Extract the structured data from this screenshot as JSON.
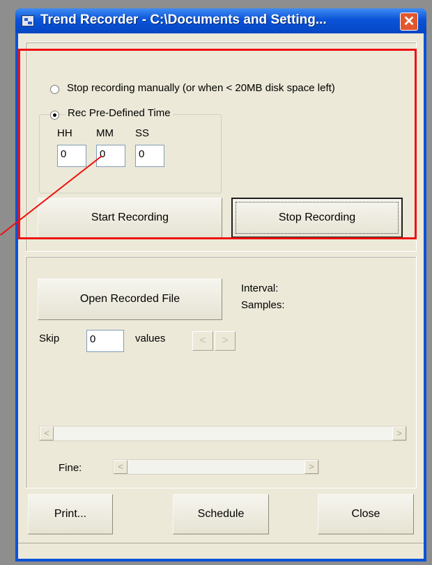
{
  "window": {
    "title": "Trend Recorder - C:\\Documents and Setting...",
    "close_icon": "close-icon"
  },
  "recording": {
    "radio_manual_label": "Stop recording manually (or when < 20MB disk space left)",
    "radio_predefined_label": "Rec Pre-Defined Time",
    "selected_mode": "Rec Pre-Defined Time",
    "hh_label": "HH",
    "mm_label": "MM",
    "ss_label": "SS",
    "hh_value": "0",
    "mm_value": "0",
    "ss_value": "0",
    "start_label": "Start Recording",
    "stop_label": "Stop Recording"
  },
  "playback": {
    "open_file_label": "Open Recorded File",
    "interval_label": "Interval:",
    "samples_label": "Samples:",
    "skip_label": "Skip",
    "skip_value": "0",
    "values_label": "values",
    "prev_icon": "<",
    "next_icon": ">",
    "scroll_left_icon": "<",
    "scroll_right_icon": ">",
    "fine_label": "Fine:"
  },
  "footer": {
    "print_label": "Print...",
    "schedule_label": "Schedule",
    "close_label": "Close"
  },
  "colors": {
    "highlight": "#ee1111",
    "title_bar": "#0a53d8",
    "dialog_bg": "#ece9d8"
  }
}
